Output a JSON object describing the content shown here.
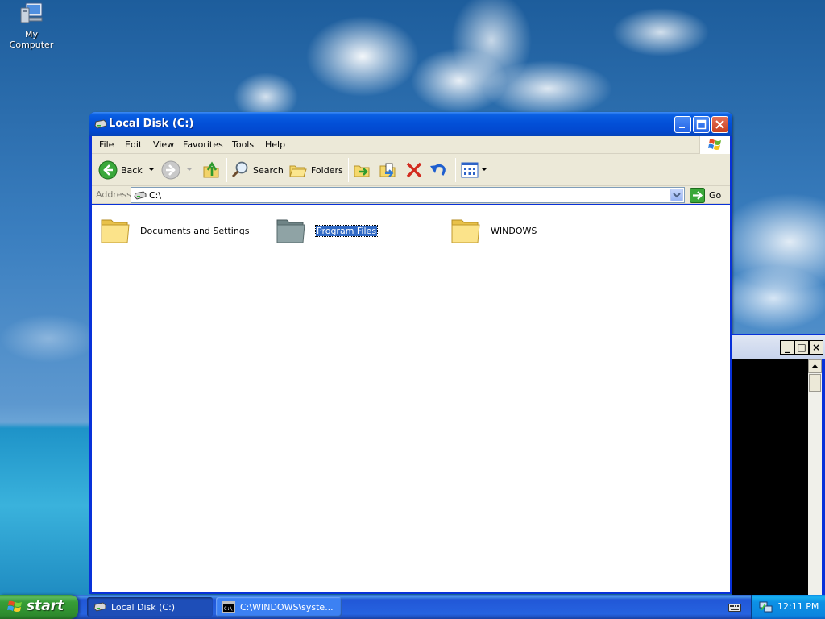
{
  "desktop": {
    "icons": [
      {
        "label": "My Computer",
        "icon": "my-computer-icon"
      }
    ]
  },
  "explorer": {
    "title": "Local Disk (C:)",
    "menu": [
      "File",
      "Edit",
      "View",
      "Favorites",
      "Tools",
      "Help"
    ],
    "toolbar": {
      "back_label": "Back",
      "search_label": "Search",
      "folders_label": "Folders"
    },
    "address": {
      "label": "Address",
      "value": "C:\\",
      "go_label": "Go"
    },
    "folders": [
      {
        "name": "Documents and Settings",
        "selected": false
      },
      {
        "name": "Program Files",
        "selected": true
      },
      {
        "name": "WINDOWS",
        "selected": false
      }
    ]
  },
  "console": {
    "buttons": [
      "_",
      "□",
      "×"
    ]
  },
  "taskbar": {
    "start_label": "start",
    "tasks": [
      {
        "label": "Local Disk (C:)",
        "active": true
      },
      {
        "label": "C:\\WINDOWS\\syste...",
        "active": false
      }
    ],
    "clock": "12:11 PM"
  },
  "colors": {
    "title_blue": "#0250d8",
    "selection": "#316ac5",
    "start_green": "#379e37",
    "taskbar_blue": "#2663e0"
  }
}
